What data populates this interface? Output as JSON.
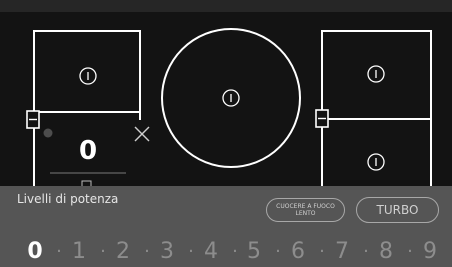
{
  "cooktop": {
    "selected_zone_level": "0",
    "zone_power_symbol": "I"
  },
  "panel": {
    "title": "Livelli di potenza",
    "slow_cook_label": "CUOCERE A FUOCO LENTO",
    "turbo_label": "TURBO"
  },
  "levels": {
    "selected": "0",
    "items": [
      "0",
      "1",
      "2",
      "3",
      "4",
      "5",
      "6",
      "7",
      "8",
      "9"
    ],
    "separator": "·"
  },
  "colors": {
    "background": "#131313",
    "panel": "#555555",
    "outline": "#ffffff",
    "inactive_level": "#8d8d8d"
  },
  "icons": {
    "zone": "power-icon",
    "close": "close-icon",
    "link": "zone-bridge-icon"
  }
}
